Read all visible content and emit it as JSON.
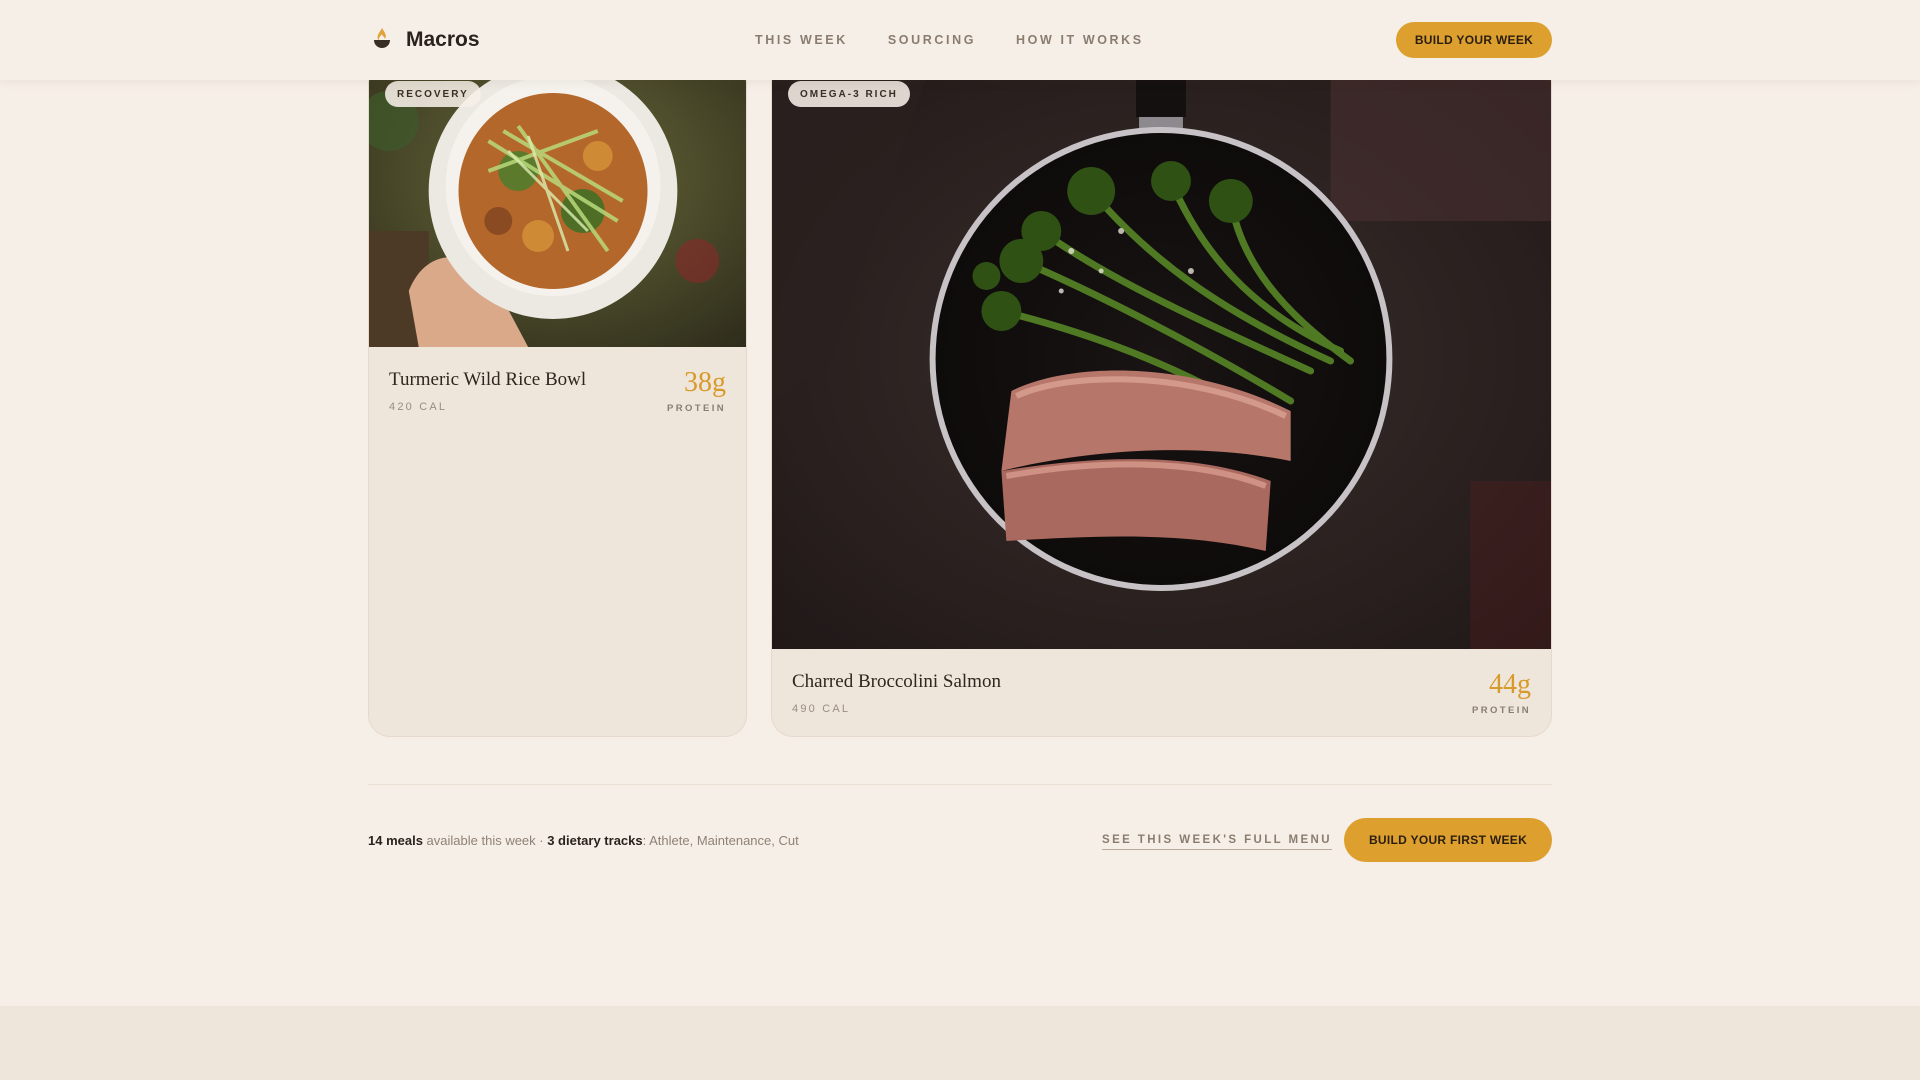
{
  "header": {
    "brand": "Macros",
    "nav": [
      "THIS WEEK",
      "SOURCING",
      "HOW IT WORKS"
    ],
    "cta": "BUILD YOUR WEEK"
  },
  "meals": [
    {
      "badge": "RECOVERY",
      "name": "Turmeric Wild Rice Bowl",
      "calories": "420 CAL",
      "protein": "38g",
      "protein_label": "PROTEIN"
    },
    {
      "badge": "OMEGA-3 RICH",
      "name": "Charred Broccolini Salmon",
      "calories": "490 CAL",
      "protein": "44g",
      "protein_label": "PROTEIN"
    }
  ],
  "summary": {
    "meals_count": "14 meals",
    "meals_text": " available this week · ",
    "tracks_count": "3 dietary tracks",
    "tracks_text": ": Athlete, Maintenance, Cut"
  },
  "actions": {
    "full_menu": "SEE THIS WEEK'S FULL MENU",
    "build_first": "BUILD YOUR FIRST WEEK"
  },
  "colors": {
    "accent": "#dd9f2e",
    "background": "#f6efe7",
    "card": "#efe6db"
  },
  "icons": {
    "brand": "flame-bowl-icon"
  }
}
